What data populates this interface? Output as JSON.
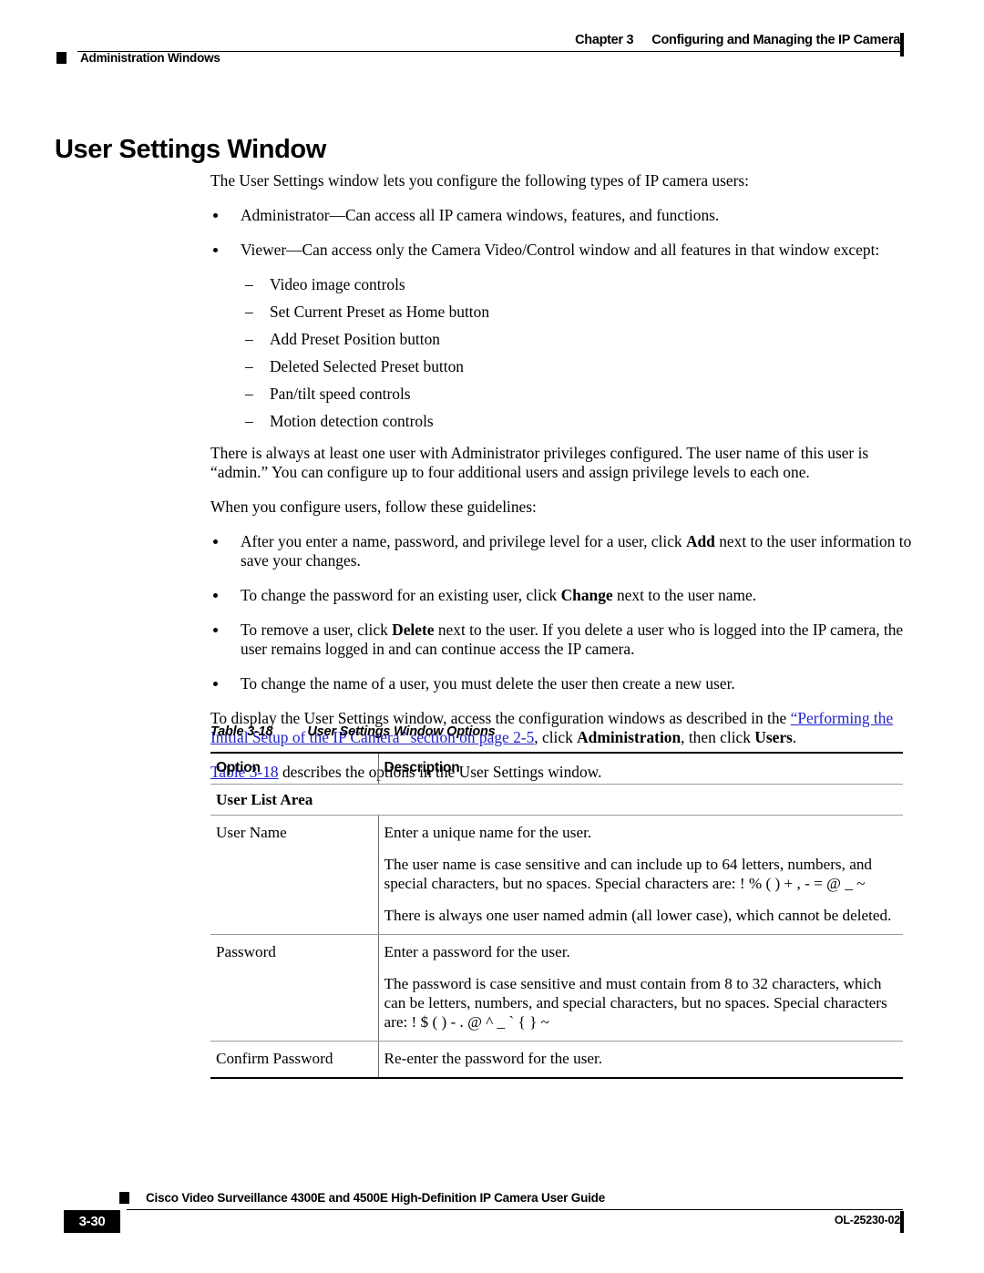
{
  "header": {
    "chapter_number": "Chapter 3",
    "chapter_title": "Configuring and Managing the IP Camera",
    "section_label": "Administration Windows"
  },
  "page_title": "User Settings Window",
  "intro": {
    "lead": "The User Settings window lets you configure the following types of IP camera users:",
    "user_types": [
      "Administrator—Can access all IP camera windows, features, and functions.",
      "Viewer—Can access only the Camera Video/Control window and all features in that window except:"
    ],
    "viewer_exceptions": [
      "Video image controls",
      "Set Current Preset as Home button",
      "Add Preset Position button",
      "Deleted Selected Preset button",
      "Pan/tilt speed controls",
      "Motion detection controls"
    ],
    "admin_note": "There is always at least one user with Administrator privileges configured. The user name of this user is “admin.” You can configure up to four additional users and assign privilege levels to each one.",
    "guidelines_lead": "When you configure users, follow these guidelines:"
  },
  "guidelines": [
    {
      "pre": "After you enter a name, password, and privilege level for a user, click ",
      "bold": "Add",
      "post": " next to the user information to save your changes."
    },
    {
      "pre": "To change the password for an existing user, click ",
      "bold": "Change",
      "post": " next to the user name."
    },
    {
      "pre": "To remove a user, click ",
      "bold": "Delete",
      "post": " next to the user. If you delete a user who is logged into the IP camera, the user remains logged in and can continue access the IP camera."
    },
    {
      "pre": "To change the name of a user, you must delete the user then create a new user.",
      "bold": "",
      "post": ""
    }
  ],
  "access_para": {
    "pre": "To display the User Settings window, access the configuration windows as described in the ",
    "link": "“Performing the Initial Setup of the IP Camera” section on page 2-5",
    "mid": ", click ",
    "bold1": "Administration",
    "mid2": ", then click ",
    "bold2": "Users",
    "post": "."
  },
  "table_ref_para": {
    "link": "Table 3-18",
    "rest": " describes the options in the User Settings window."
  },
  "table": {
    "caption_number": "Table 3-18",
    "caption_title": "User Settings Window Options",
    "columns": [
      "Option",
      "Description"
    ],
    "section_heading": "User List Area",
    "rows": [
      {
        "option": "User Name",
        "description": [
          "Enter a unique name for the user.",
          "The user name is case sensitive and can include up to 64 letters, numbers, and special characters, but no spaces. Special characters are: ! % ( ) + , - = @ _ ~",
          "There is always one user named admin (all lower case), which cannot be deleted."
        ]
      },
      {
        "option": "Password",
        "description": [
          "Enter a password for the user.",
          "The password is case sensitive and must contain from 8 to 32 characters, which can be letters, numbers, and special characters, but no spaces. Special characters are: ! $ ( ) - . @ ^ _ ` { } ~"
        ]
      },
      {
        "option": "Confirm Password",
        "description": [
          "Re-enter the password for the user."
        ]
      }
    ]
  },
  "footer": {
    "guide_title": "Cisco Video Surveillance 4300E and 4500E High-Definition IP Camera User Guide",
    "page_number": "3-30",
    "doc_id": "OL-25230-02"
  },
  "colors": {
    "link": "#2222cc",
    "rule": "#000000"
  }
}
